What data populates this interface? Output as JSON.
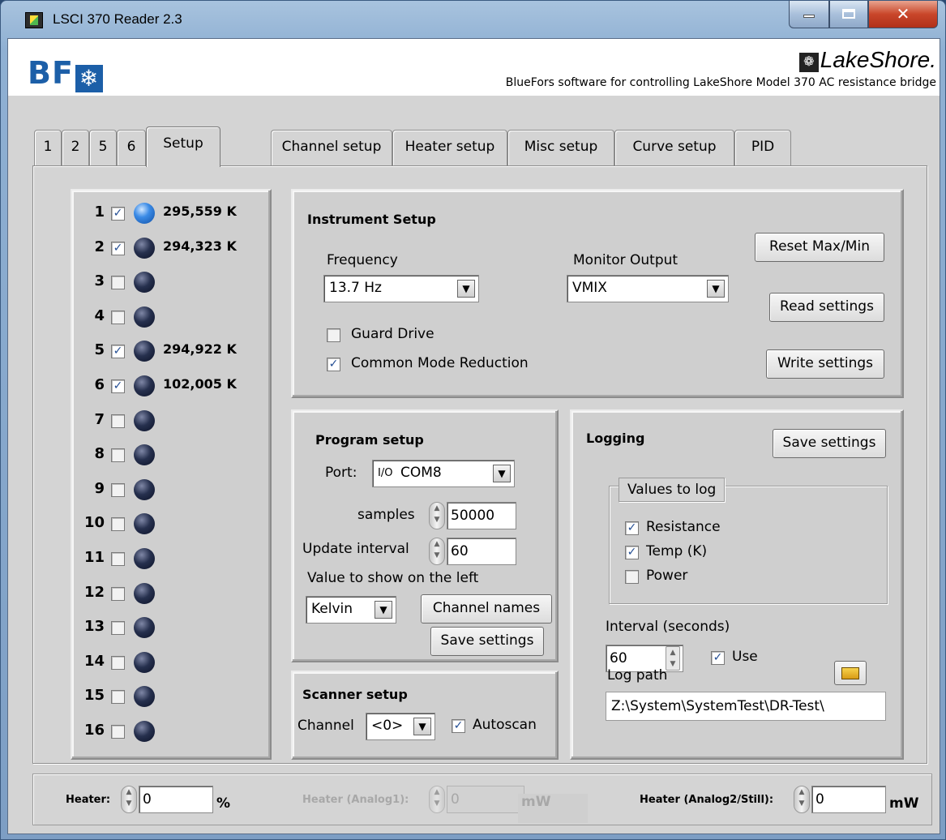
{
  "window": {
    "title": "LSCI 370 Reader 2.3"
  },
  "banner": {
    "logo_text": "BF",
    "brand": "LakeShore.",
    "subtitle": "BlueFors software for controlling LakeShore Model 370 AC resistance bridge"
  },
  "tabs": [
    "1",
    "2",
    "5",
    "6",
    "Setup",
    "Channel setup",
    "Heater setup",
    "Misc setup",
    "Curve setup",
    "PID"
  ],
  "active_tab": "Setup",
  "channels": [
    {
      "num": "1",
      "checked": true,
      "on": true,
      "value": "295,559 K"
    },
    {
      "num": "2",
      "checked": true,
      "on": false,
      "value": "294,323 K"
    },
    {
      "num": "3",
      "checked": false,
      "on": false,
      "value": ""
    },
    {
      "num": "4",
      "checked": false,
      "on": false,
      "value": ""
    },
    {
      "num": "5",
      "checked": true,
      "on": false,
      "value": "294,922 K"
    },
    {
      "num": "6",
      "checked": true,
      "on": false,
      "value": "102,005 K"
    },
    {
      "num": "7",
      "checked": false,
      "on": false,
      "value": ""
    },
    {
      "num": "8",
      "checked": false,
      "on": false,
      "value": ""
    },
    {
      "num": "9",
      "checked": false,
      "on": false,
      "value": ""
    },
    {
      "num": "10",
      "checked": false,
      "on": false,
      "value": ""
    },
    {
      "num": "11",
      "checked": false,
      "on": false,
      "value": ""
    },
    {
      "num": "12",
      "checked": false,
      "on": false,
      "value": ""
    },
    {
      "num": "13",
      "checked": false,
      "on": false,
      "value": ""
    },
    {
      "num": "14",
      "checked": false,
      "on": false,
      "value": ""
    },
    {
      "num": "15",
      "checked": false,
      "on": false,
      "value": ""
    },
    {
      "num": "16",
      "checked": false,
      "on": false,
      "value": ""
    }
  ],
  "instrument": {
    "title": "Instrument Setup",
    "frequency_label": "Frequency",
    "frequency_value": "13.7 Hz",
    "monitor_label": "Monitor Output",
    "monitor_value": "VMIX",
    "guard_drive_label": "Guard Drive",
    "guard_drive_checked": false,
    "cmr_label": "Common Mode Reduction",
    "cmr_checked": true,
    "reset_btn": "Reset Max/Min",
    "read_btn": "Read settings",
    "write_btn": "Write settings"
  },
  "program": {
    "title": "Program setup",
    "port_label": "Port:",
    "port_prefix": "I/O",
    "port_value": "COM8",
    "samples_label": "samples",
    "samples_value": "50000",
    "update_label": "Update interval",
    "update_value": "60",
    "show_label": "Value to show on the left",
    "show_value": "Kelvin",
    "channel_names_btn": "Channel names",
    "save_btn": "Save settings"
  },
  "scanner": {
    "title": "Scanner setup",
    "channel_label": "Channel",
    "channel_value": "<0>",
    "autoscan_label": "Autoscan",
    "autoscan_checked": true
  },
  "logging": {
    "title": "Logging",
    "save_btn": "Save settings",
    "values_legend": "Values to log",
    "resistance_label": "Resistance",
    "resistance_checked": true,
    "temp_label": "Temp (K)",
    "temp_checked": true,
    "power_label": "Power",
    "power_checked": false,
    "interval_label": "Interval (seconds)",
    "interval_value": "60",
    "use_label": "Use",
    "use_checked": true,
    "path_label": "Log path",
    "path_value": "Z:\\System\\SystemTest\\DR-Test\\"
  },
  "bottom": {
    "heater_label": "Heater:",
    "heater_value": "0",
    "heater_unit": "%",
    "analog1_label": "Heater (Analog1):",
    "analog1_value": "0",
    "analog1_unit": "mW",
    "analog2_label": "Heater (Analog2/Still):",
    "analog2_value": "0",
    "analog2_unit": "mW"
  }
}
